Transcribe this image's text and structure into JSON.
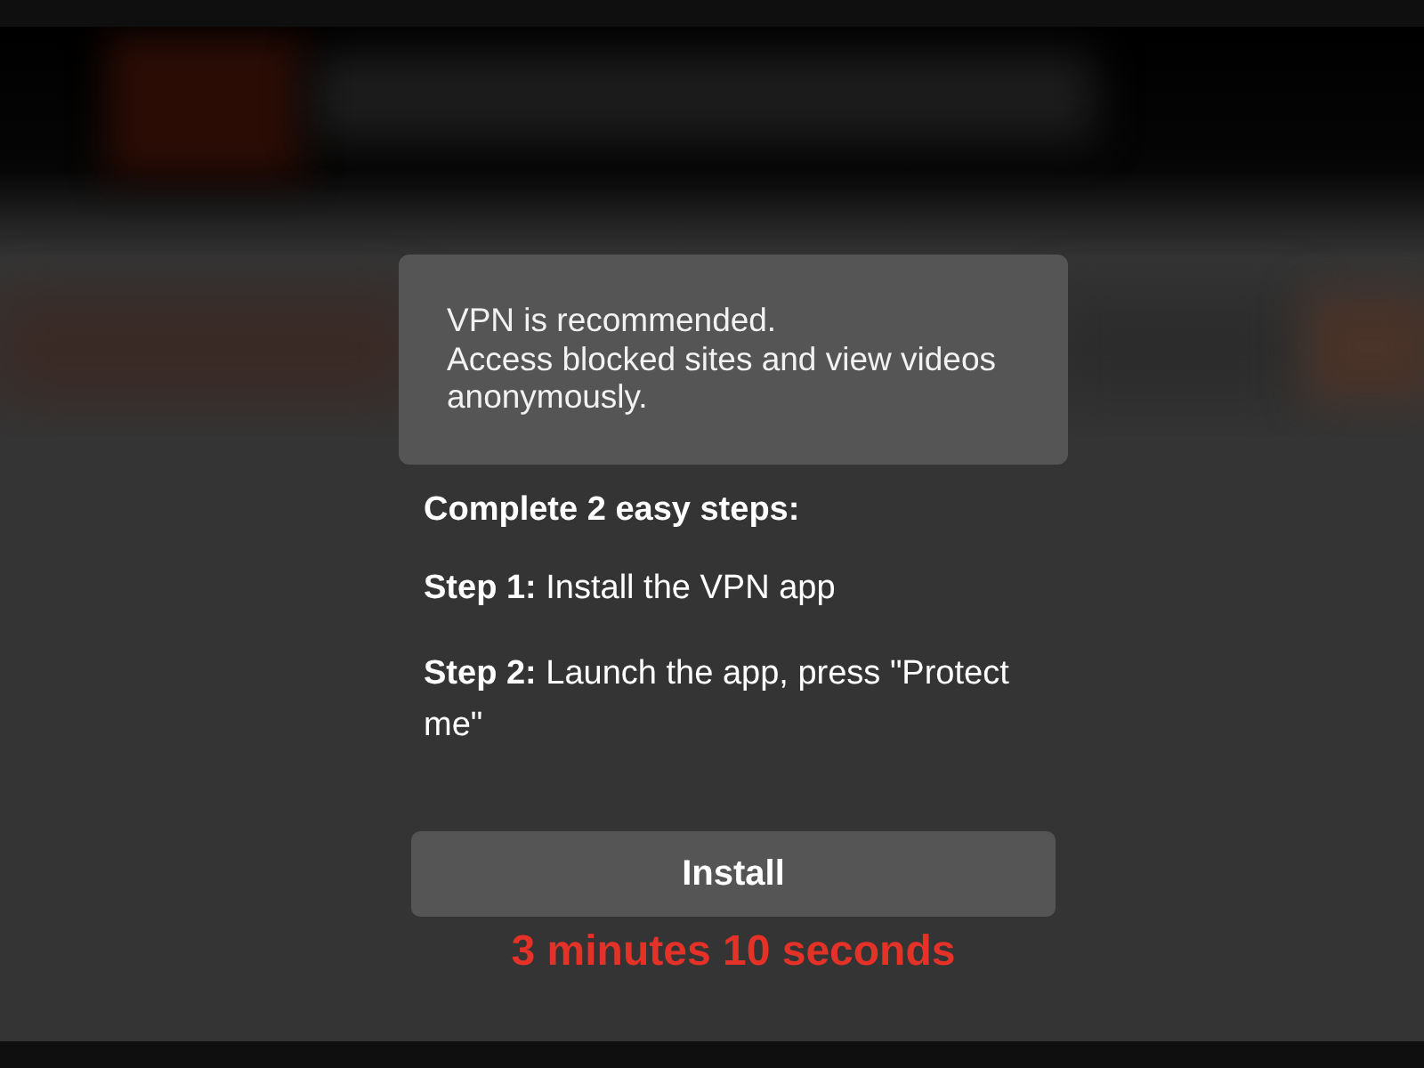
{
  "notice": {
    "lines": [
      "VPN is recommended.",
      "Access blocked sites and view videos anonymously."
    ]
  },
  "steps": {
    "heading": "Complete 2 easy steps:",
    "items": [
      "**Step 1:** Install the VPN app",
      "**Step 2:** Launch the app, press \"Protect me\""
    ]
  },
  "install_button": {
    "label": "Install"
  },
  "countdown": "3 minutes 10 seconds"
}
